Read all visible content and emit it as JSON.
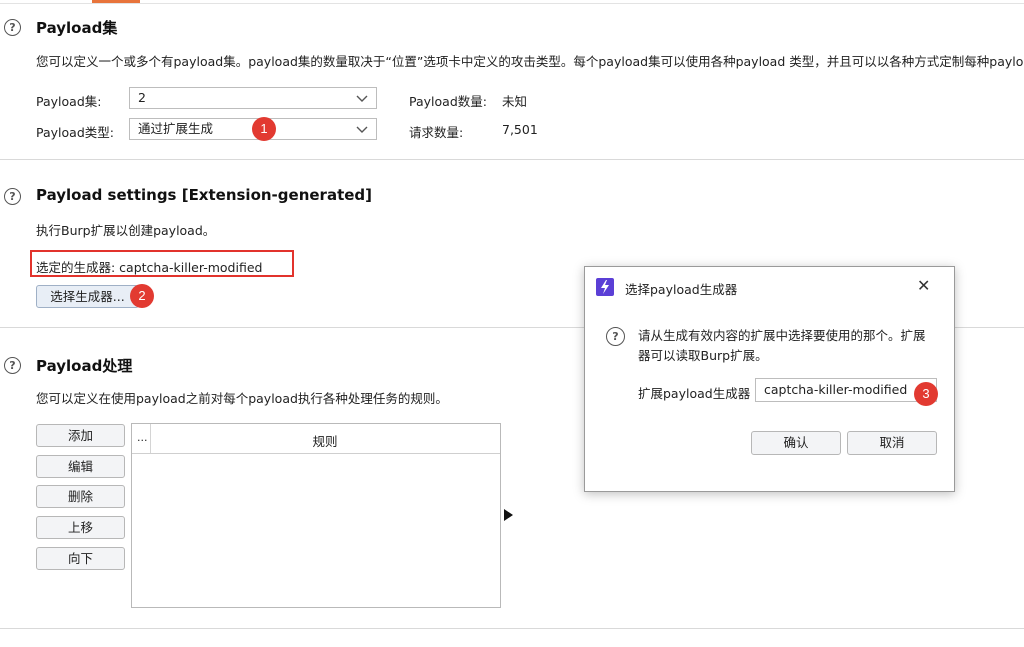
{
  "sections": {
    "payload_sets": {
      "title": "Payload集",
      "description": "您可以定义一个或多个有payload集。payload集的数量取决于“位置”选项卡中定义的攻击类型。每个payload集可以使用各种payload 类型，并且可以以各种方式定制每种payload",
      "set_label": "Payload集:",
      "set_value": "2",
      "type_label": "Payload类型:",
      "type_value": "通过扩展生成",
      "count_label": "Payload数量:",
      "count_value": "未知",
      "request_label": "请求数量:",
      "request_value": "7,501"
    },
    "payload_settings": {
      "title": "Payload settings [Extension-generated]",
      "description": "执行Burp扩展以创建payload。",
      "selected_generator": "选定的生成器: captcha-killer-modified",
      "select_button": "选择生成器..."
    },
    "payload_processing": {
      "title": "Payload处理",
      "description": "您可以定义在使用payload之前对每个payload执行各种处理任务的规则。",
      "buttons": [
        "添加",
        "编辑",
        "删除",
        "上移",
        "向下"
      ],
      "table": {
        "col_enabled": "...",
        "col_rule": "规则"
      }
    }
  },
  "annotations": [
    "1",
    "2",
    "3"
  ],
  "dialog": {
    "title": "选择payload生成器",
    "message_line1": "请从生成有效内容的扩展中选择要使用的那个。扩展",
    "message_line2": "器可以读取Burp扩展。",
    "field_label": "扩展payload生成器",
    "field_value": "captcha-killer-modified",
    "ok_label": "确认",
    "cancel_label": "取消",
    "close_glyph": "✕"
  },
  "icons": {
    "help": "question-circle-icon",
    "dropdown": "chevron-down-icon",
    "app": "burp-lightning-icon",
    "close": "close-icon",
    "cursor": "mouse-cursor-icon"
  },
  "colors": {
    "accent_tab": "#e8743b",
    "annotation_red": "#e23a31",
    "app_icon": "#5b3fd6"
  }
}
